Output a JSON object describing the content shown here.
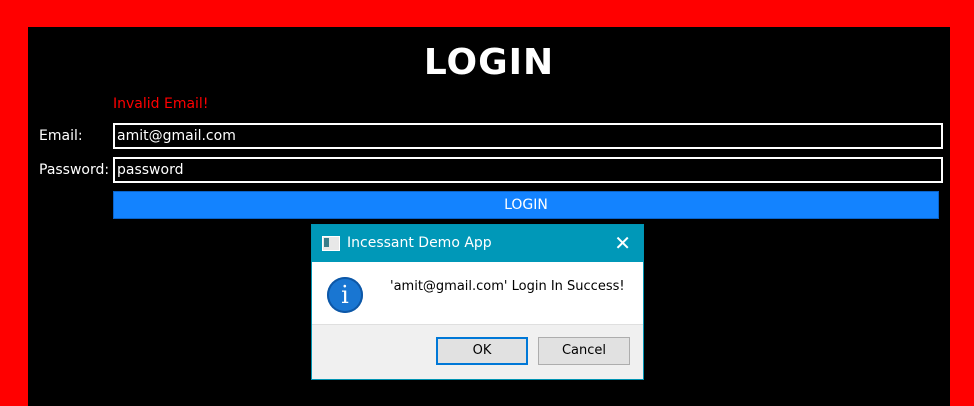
{
  "form": {
    "title": "LOGIN",
    "error": "Invalid Email!",
    "email_label": "Email:",
    "email_value": "amit@gmail.com",
    "password_label": "Password:",
    "password_value": "password",
    "login_button": "LOGIN"
  },
  "dialog": {
    "title": "Incessant Demo App",
    "close": "✕",
    "message": "'amit@gmail.com' Login In Success!",
    "info_icon": "i",
    "ok_label": "OK",
    "cancel_label": "Cancel"
  },
  "colors": {
    "frame": "#ff0000",
    "background": "#000000",
    "login_button": "#1383ff",
    "dialog_titlebar": "#0098b8"
  }
}
